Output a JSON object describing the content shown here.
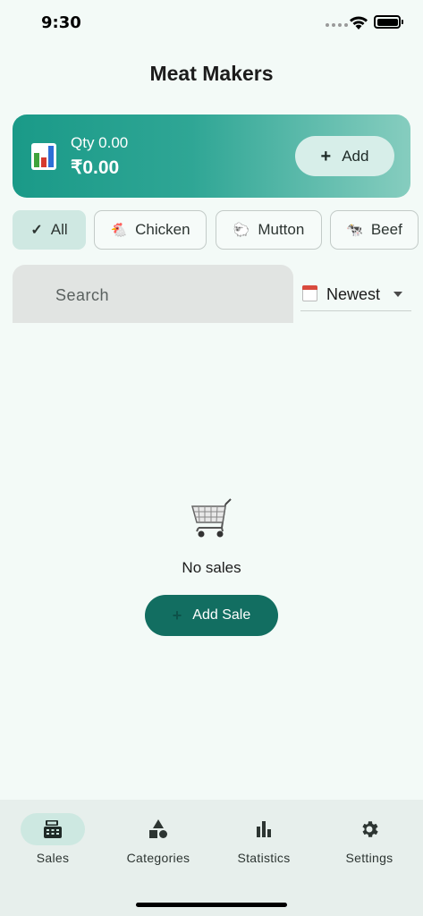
{
  "status_bar": {
    "time": "9:30"
  },
  "header": {
    "title": "Meat Makers"
  },
  "summary": {
    "icon": "bar-chart-icon",
    "qty": "Qty 0.00",
    "amount": "₹0.00",
    "add_label": "Add"
  },
  "filters": {
    "chips": [
      {
        "label": "All",
        "icon": "check-icon",
        "selected": true
      },
      {
        "label": "Chicken",
        "icon": "🐔",
        "selected": false
      },
      {
        "label": "Mutton",
        "icon": "🐑",
        "selected": false
      },
      {
        "label": "Beef",
        "icon": "🐄",
        "selected": false
      }
    ]
  },
  "search": {
    "placeholder": "Search"
  },
  "sort": {
    "icon": "calendar-icon",
    "selected": "Newest"
  },
  "empty_state": {
    "icon": "shopping-cart-icon",
    "message": "No sales",
    "button_label": "Add Sale"
  },
  "bottom_nav": {
    "items": [
      {
        "label": "Sales",
        "icon": "cash-register-icon",
        "active": true
      },
      {
        "label": "Categories",
        "icon": "shapes-icon",
        "active": false
      },
      {
        "label": "Statistics",
        "icon": "bar-chart-icon",
        "active": false
      },
      {
        "label": "Settings",
        "icon": "gear-icon",
        "active": false
      }
    ]
  },
  "colors": {
    "background": "#f3faf7",
    "accent": "#126e61",
    "card_gradient_start": "#1a9a88",
    "card_gradient_end": "#86cdbf",
    "chip_selected": "#cfe8e2"
  }
}
